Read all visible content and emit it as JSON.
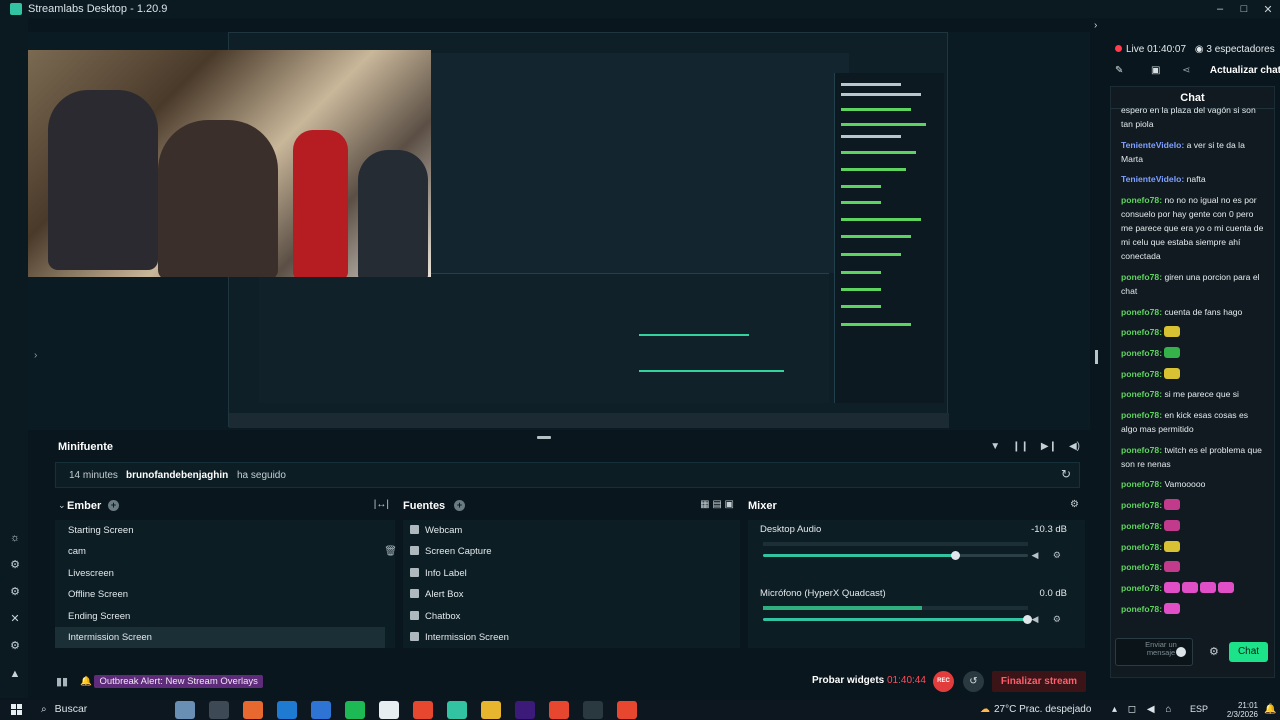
{
  "app": {
    "title": "Streamlabs Desktop - 1.20.9"
  },
  "window_controls": [
    "–",
    "□",
    "✕"
  ],
  "minifuente": {
    "title": "Minifuente",
    "event": {
      "time": "14 minutes",
      "user": "brunofandebenjaghin",
      "action": "ha seguido"
    }
  },
  "scenes": {
    "title": "Ember",
    "items": [
      "Starting Screen",
      "cam",
      "Livescreen",
      "Offline Screen",
      "Ending Screen",
      "Intermission Screen"
    ],
    "active_index": 5,
    "hover_index": 1
  },
  "sources": {
    "title": "Fuentes",
    "items": [
      "Webcam",
      "Screen Capture",
      "Info Label",
      "Alert Box",
      "Chatbox",
      "Intermission Screen"
    ]
  },
  "mixer": {
    "title": "Mixer",
    "channels": [
      {
        "name": "Desktop Audio",
        "db": "-10.3 dB",
        "volume": 0.73,
        "level": 0.0
      },
      {
        "name": "Micrófono (HyperX Quadcast)",
        "db": "0.0 dB",
        "volume": 1.0,
        "level": 0.6
      }
    ]
  },
  "footer": {
    "alert": "Outbreak Alert: New Stream Overlays",
    "test_widgets": "Probar widgets",
    "time": "01:40:44",
    "rec": "REC",
    "end_stream": "Finalizar stream"
  },
  "right_panel": {
    "live_status": "Live 01:40:07",
    "viewers": "3 espectadores",
    "update_label": "Actualizar chat",
    "chat_title": "Chat",
    "input_placeholder": "Enviar un mensaje",
    "send_label": "Chat",
    "messages": [
      {
        "user": "",
        "text": "espero en la plaza del vagón si son tan piola",
        "user_color": "#e6ecef",
        "emotes": []
      },
      {
        "user": "TenienteVideIo:",
        "text": " a ver si te da la Marta",
        "user_color": "#7fa0ff",
        "emotes": []
      },
      {
        "user": "TenienteVideIo:",
        "text": " nafta",
        "user_color": "#7fa0ff",
        "emotes": []
      },
      {
        "user": "ponefo78:",
        "text": " no no no igual no es por consuelo por hay gente con 0 pero me parece que era yo o mi cuenta de mi celu que estaba siempre ahí conectada",
        "user_color": "#5fd35f",
        "emotes": []
      },
      {
        "user": "ponefo78:",
        "text": " giren una porcion para el chat",
        "user_color": "#5fd35f",
        "emotes": []
      },
      {
        "user": "ponefo78:",
        "text": " cuenta de fans hago",
        "user_color": "#5fd35f",
        "emotes": []
      },
      {
        "user": "ponefo78:",
        "text": "",
        "user_color": "#5fd35f",
        "emotes": [
          "#d8c234"
        ]
      },
      {
        "user": "ponefo78:",
        "text": "",
        "user_color": "#5fd35f",
        "emotes": [
          "#35b24a"
        ]
      },
      {
        "user": "ponefo78:",
        "text": "",
        "user_color": "#5fd35f",
        "emotes": [
          "#d8c234"
        ]
      },
      {
        "user": "ponefo78:",
        "text": " si me parece que si",
        "user_color": "#5fd35f",
        "emotes": []
      },
      {
        "user": "ponefo78:",
        "text": " en kick esas cosas es algo mas permitido",
        "user_color": "#5fd35f",
        "emotes": []
      },
      {
        "user": "ponefo78:",
        "text": " twitch es el problema que son re nenas",
        "user_color": "#5fd35f",
        "emotes": []
      },
      {
        "user": "ponefo78:",
        "text": " Vamooooo",
        "user_color": "#5fd35f",
        "emotes": []
      },
      {
        "user": "ponefo78:",
        "text": "",
        "user_color": "#5fd35f",
        "emotes": [
          "#c23a8c"
        ]
      },
      {
        "user": "ponefo78:",
        "text": "",
        "user_color": "#5fd35f",
        "emotes": [
          "#c23a8c"
        ]
      },
      {
        "user": "ponefo78:",
        "text": "",
        "user_color": "#5fd35f",
        "emotes": [
          "#d8c234"
        ]
      },
      {
        "user": "ponefo78:",
        "text": "",
        "user_color": "#5fd35f",
        "emotes": [
          "#c23a8c"
        ]
      },
      {
        "user": "ponefo78:",
        "text": "",
        "user_color": "#5fd35f",
        "emotes": [
          "#e04fc6",
          "#e04fc6",
          "#e04fc6",
          "#e04fc6"
        ]
      },
      {
        "user": "ponefo78:",
        "text": "",
        "user_color": "#5fd35f",
        "emotes": [
          "#e04fc6"
        ]
      }
    ]
  },
  "taskbar": {
    "search": "Buscar",
    "weather": "27°C  Prac. despejado",
    "lang": "ESP",
    "time": "21:01",
    "date": "2/3/2026"
  },
  "colors": {
    "accent": "#31c3a2",
    "live": "#ff3d4c",
    "send": "#1ce38a"
  }
}
